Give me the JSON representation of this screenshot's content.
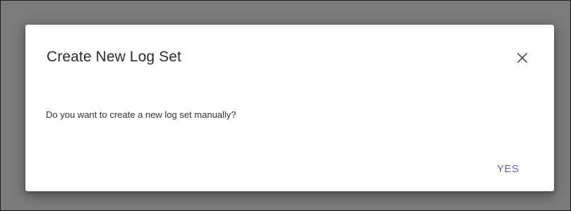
{
  "dialog": {
    "title": "Create New Log Set",
    "message": "Do you want to create a new log set manually?",
    "confirm_label": "YES",
    "close_icon": "close-icon",
    "accent_color": "#6b63b5"
  }
}
